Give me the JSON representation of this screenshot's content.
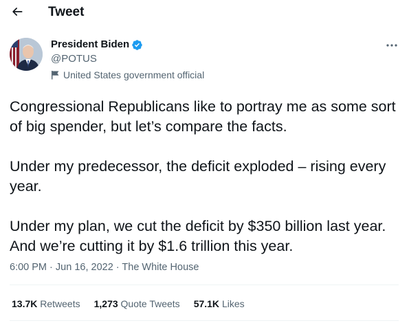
{
  "header": {
    "title": "Tweet"
  },
  "author": {
    "display_name": "President Biden",
    "handle": "@POTUS",
    "label": "United States government official"
  },
  "tweet": {
    "paragraphs": [
      "Congressional Republicans like to portray me as some sort of big spender, but let’s compare the facts.",
      "Under my predecessor, the deficit exploded – rising every year.",
      "Under my plan, we cut the deficit by $350 billion last year. And we’re cutting it by $1.6 trillion this year."
    ],
    "time": "6:00 PM",
    "date": "Jun 16, 2022",
    "source": "The White House",
    "separator": "·"
  },
  "stats": {
    "retweets_count": "13.7K",
    "retweets_label": "Retweets",
    "quotes_count": "1,273",
    "quotes_label": "Quote Tweets",
    "likes_count": "57.1K",
    "likes_label": "Likes"
  },
  "colors": {
    "verified": "#1d9bf0",
    "secondary_text": "#536471",
    "primary_text": "#0f1419",
    "divider": "#eff3f4"
  },
  "icons": [
    "back-arrow-icon",
    "verified-badge-icon",
    "government-flag-icon",
    "more-options-icon"
  ]
}
